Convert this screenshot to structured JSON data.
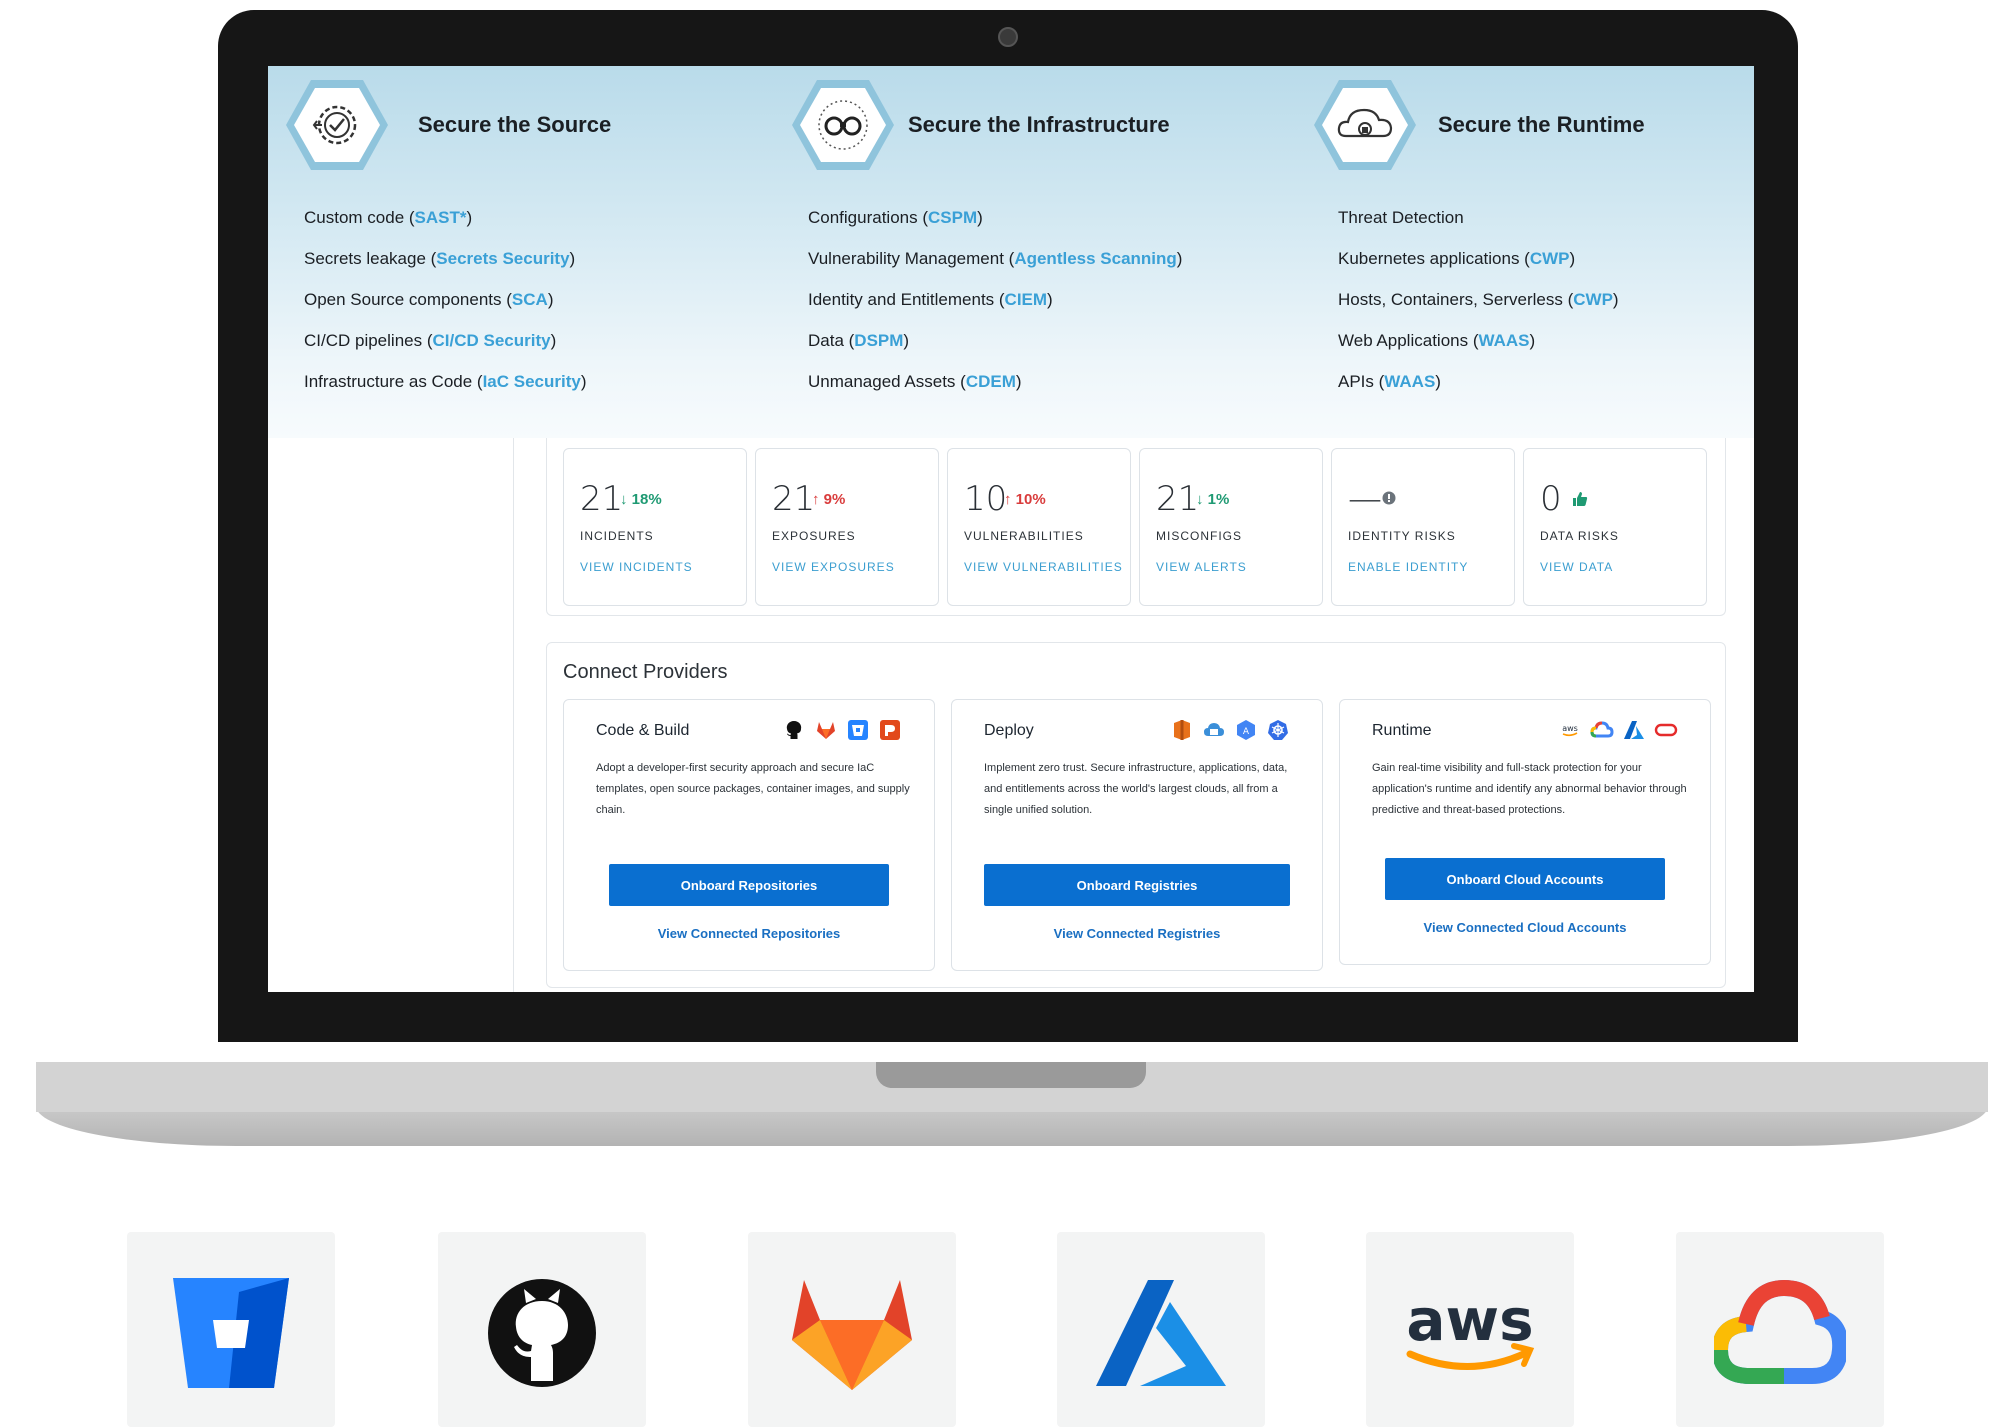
{
  "banner": {
    "columns": [
      {
        "title": "Secure the Source",
        "icon": "gear-check-icon",
        "items": [
          {
            "text": "Custom code (",
            "hl": "SAST*",
            "end": ")"
          },
          {
            "text": "Secrets leakage (",
            "hl": "Secrets Security",
            "end": ")"
          },
          {
            "text": "Open Source components (",
            "hl": "SCA",
            "end": ")"
          },
          {
            "text": "CI/CD pipelines (",
            "hl": "CI/CD Security",
            "end": ")"
          },
          {
            "text": "Infrastructure as Code (",
            "hl": "IaC Security",
            "end": ")"
          }
        ]
      },
      {
        "title": "Secure the Infrastructure",
        "icon": "binoculars-icon",
        "items": [
          {
            "text": "Configurations (",
            "hl": "CSPM",
            "end": ")"
          },
          {
            "text": "Vulnerability Management  (",
            "hl": "Agentless Scanning",
            "end": ")"
          },
          {
            "text": "Identity and Entitlements (",
            "hl": "CIEM",
            "end": ")"
          },
          {
            "text": "Data (",
            "hl": "DSPM",
            "end": ")"
          },
          {
            "text": "Unmanaged Assets (",
            "hl": "CDEM",
            "end": ")"
          }
        ]
      },
      {
        "title": "Secure the Runtime",
        "icon": "cloud-lock-icon",
        "items": [
          {
            "text": "Threat Detection",
            "hl": "",
            "end": ""
          },
          {
            "text": "Kubernetes applications (",
            "hl": "CWP",
            "end": ")"
          },
          {
            "text": "Hosts, Containers, Serverless (",
            "hl": "CWP",
            "end": ")"
          },
          {
            "text": "Web Applications (",
            "hl": "WAAS",
            "end": ")"
          },
          {
            "text": "APIs (",
            "hl": "WAAS",
            "end": ")"
          }
        ]
      }
    ]
  },
  "stats": [
    {
      "value": "21",
      "delta": "18%",
      "dir": "down",
      "label": "INCIDENTS",
      "link": "VIEW INCIDENTS"
    },
    {
      "value": "21",
      "delta": "9%",
      "dir": "up",
      "label": "EXPOSURES",
      "link": "VIEW EXPOSURES"
    },
    {
      "value": "10",
      "delta": "10%",
      "dir": "up",
      "label": "VULNERABILITIES",
      "link": "VIEW VULNERABILITIES"
    },
    {
      "value": "21",
      "delta": "1%",
      "dir": "down",
      "label": "MISCONFIGS",
      "link": "VIEW ALERTS"
    },
    {
      "value": "—",
      "delta": "",
      "dir": "info",
      "label": "IDENTITY RISKS",
      "link": "ENABLE IDENTITY"
    },
    {
      "value": "0",
      "delta": "",
      "dir": "thumb",
      "label": "DATA RISKS",
      "link": "VIEW DATA"
    }
  ],
  "providers": {
    "title": "Connect Providers",
    "cards": [
      {
        "title": "Code & Build",
        "desc": "Adopt a developer-first security approach and secure IaC templates, open source packages, container images, and supply chain.",
        "button": "Onboard Repositories",
        "link": "View Connected Repositories"
      },
      {
        "title": "Deploy",
        "desc": "Implement zero trust. Secure infrastructure, applications, data, and entitlements across the world's largest clouds, all from a single unified solution.",
        "button": "Onboard Registries",
        "link": "View Connected Registries"
      },
      {
        "title": "Runtime",
        "desc": "Gain real-time visibility and full-stack  protection for your application's runtime and identify any abnormal behavior through predictive and threat-based protections.",
        "button": "Onboard Cloud Accounts",
        "link": "View Connected Cloud Accounts"
      }
    ]
  },
  "logos": [
    {
      "name": "bitbucket-logo"
    },
    {
      "name": "github-logo"
    },
    {
      "name": "gitlab-logo"
    },
    {
      "name": "azure-logo"
    },
    {
      "name": "aws-logo",
      "text": "aws"
    },
    {
      "name": "google-cloud-logo"
    }
  ],
  "colors": {
    "accent": "#3aa0d6",
    "button": "#0a6fd0",
    "up": "#d93c3c",
    "down": "#1f9a73"
  }
}
